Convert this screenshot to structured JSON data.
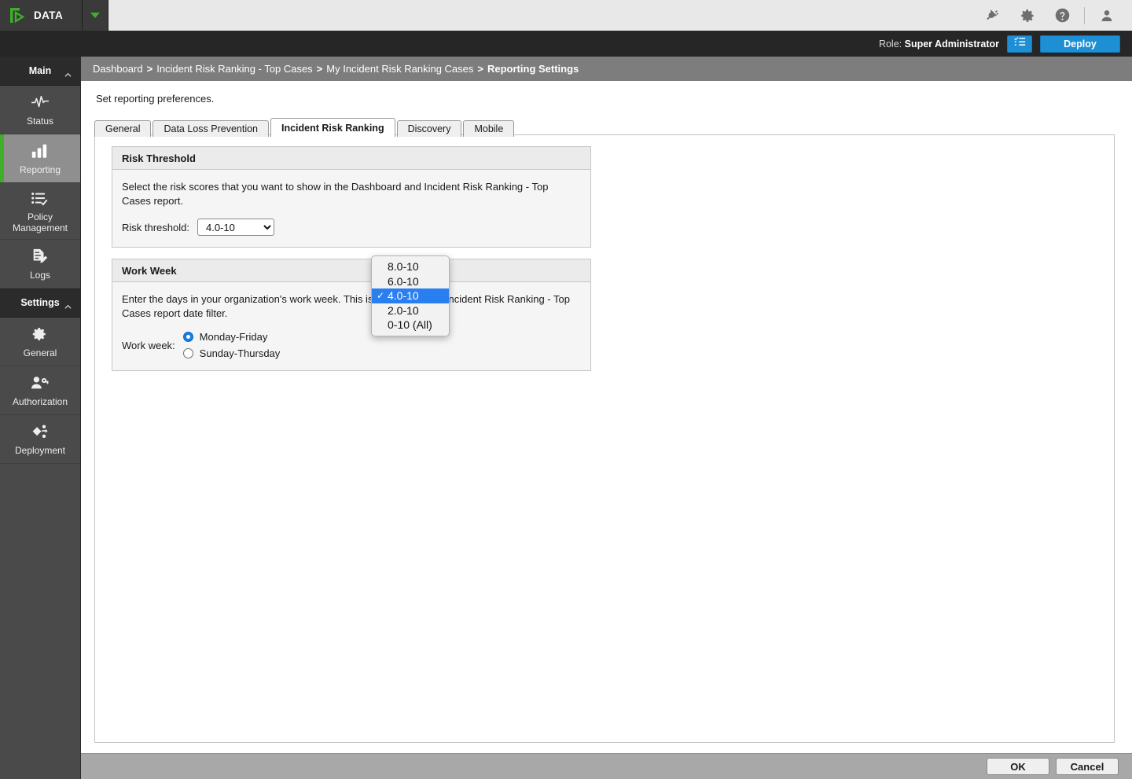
{
  "brand": {
    "name": "DATA",
    "logo_icon": "logo-bracket-play-icon",
    "caret_icon": "triangle-down-icon"
  },
  "topbar": {
    "icons": [
      {
        "name": "plug-icon",
        "label": "Plug"
      },
      {
        "name": "gear-icon",
        "label": "Settings"
      },
      {
        "name": "help-icon",
        "label": "Help"
      },
      {
        "name": "user-icon",
        "label": "Account"
      }
    ]
  },
  "rolebar": {
    "role_prefix": "Role:",
    "role_value": "Super Administrator",
    "list_button_icon": "checklist-icon",
    "deploy_label": "Deploy",
    "accent_color": "#1e8fd5"
  },
  "sidebar": {
    "sections": [
      {
        "label": "Main",
        "collapse_icon": "chevron-up-icon",
        "items": [
          {
            "label": "Status",
            "icon": "pulse-icon",
            "active": false
          },
          {
            "label": "Reporting",
            "icon": "bar-chart-icon",
            "active": true
          },
          {
            "label": "Policy Management",
            "icon": "list-check-icon",
            "active": false
          },
          {
            "label": "Logs",
            "icon": "document-edit-icon",
            "active": false
          }
        ]
      },
      {
        "label": "Settings",
        "collapse_icon": "chevron-up-icon",
        "items": [
          {
            "label": "General",
            "icon": "gear-icon",
            "active": false
          },
          {
            "label": "Authorization",
            "icon": "user-key-icon",
            "active": false
          },
          {
            "label": "Deployment",
            "icon": "deployment-nodes-icon",
            "active": false
          }
        ]
      }
    ],
    "active_accent_color": "#3fae29"
  },
  "breadcrumb": {
    "separator": ">",
    "items": [
      {
        "label": "Dashboard",
        "current": false
      },
      {
        "label": "Incident Risk Ranking - Top Cases",
        "current": false
      },
      {
        "label": "My Incident Risk Ranking Cases",
        "current": false
      },
      {
        "label": "Reporting Settings",
        "current": true
      }
    ]
  },
  "main": {
    "subtitle": "Set reporting preferences.",
    "tabs": [
      {
        "label": "General",
        "active": false
      },
      {
        "label": "Data Loss Prevention",
        "active": false
      },
      {
        "label": "Incident Risk Ranking",
        "active": true
      },
      {
        "label": "Discovery",
        "active": false
      },
      {
        "label": "Mobile",
        "active": false
      }
    ],
    "risk_threshold_card": {
      "title": "Risk Threshold",
      "description": "Select the risk scores that you want to show in the Dashboard and Incident Risk Ranking - Top Cases report.",
      "field_label": "Risk threshold:",
      "selected_value": "4.0-10",
      "options": [
        "8.0-10",
        "6.0-10",
        "4.0-10",
        "2.0-10",
        "0-10 (All)"
      ]
    },
    "work_week_card": {
      "title": "Work Week",
      "description": "Enter the days in your organization's work week. This is reflected in the Incident Risk Ranking - Top Cases report date filter.",
      "field_label": "Work week:",
      "options": [
        {
          "label": "Monday-Friday",
          "selected": true
        },
        {
          "label": "Sunday-Thursday",
          "selected": false
        }
      ]
    }
  },
  "dropdown": {
    "open": true,
    "check_glyph": "✓",
    "selected_index": 2,
    "highlight_color": "#2a7ff0",
    "items": [
      {
        "label": "8.0-10",
        "selected": false
      },
      {
        "label": "6.0-10",
        "selected": false
      },
      {
        "label": "4.0-10",
        "selected": true
      },
      {
        "label": "2.0-10",
        "selected": false
      },
      {
        "label": "0-10 (All)",
        "selected": false
      }
    ]
  },
  "footer": {
    "ok_label": "OK",
    "cancel_label": "Cancel"
  }
}
